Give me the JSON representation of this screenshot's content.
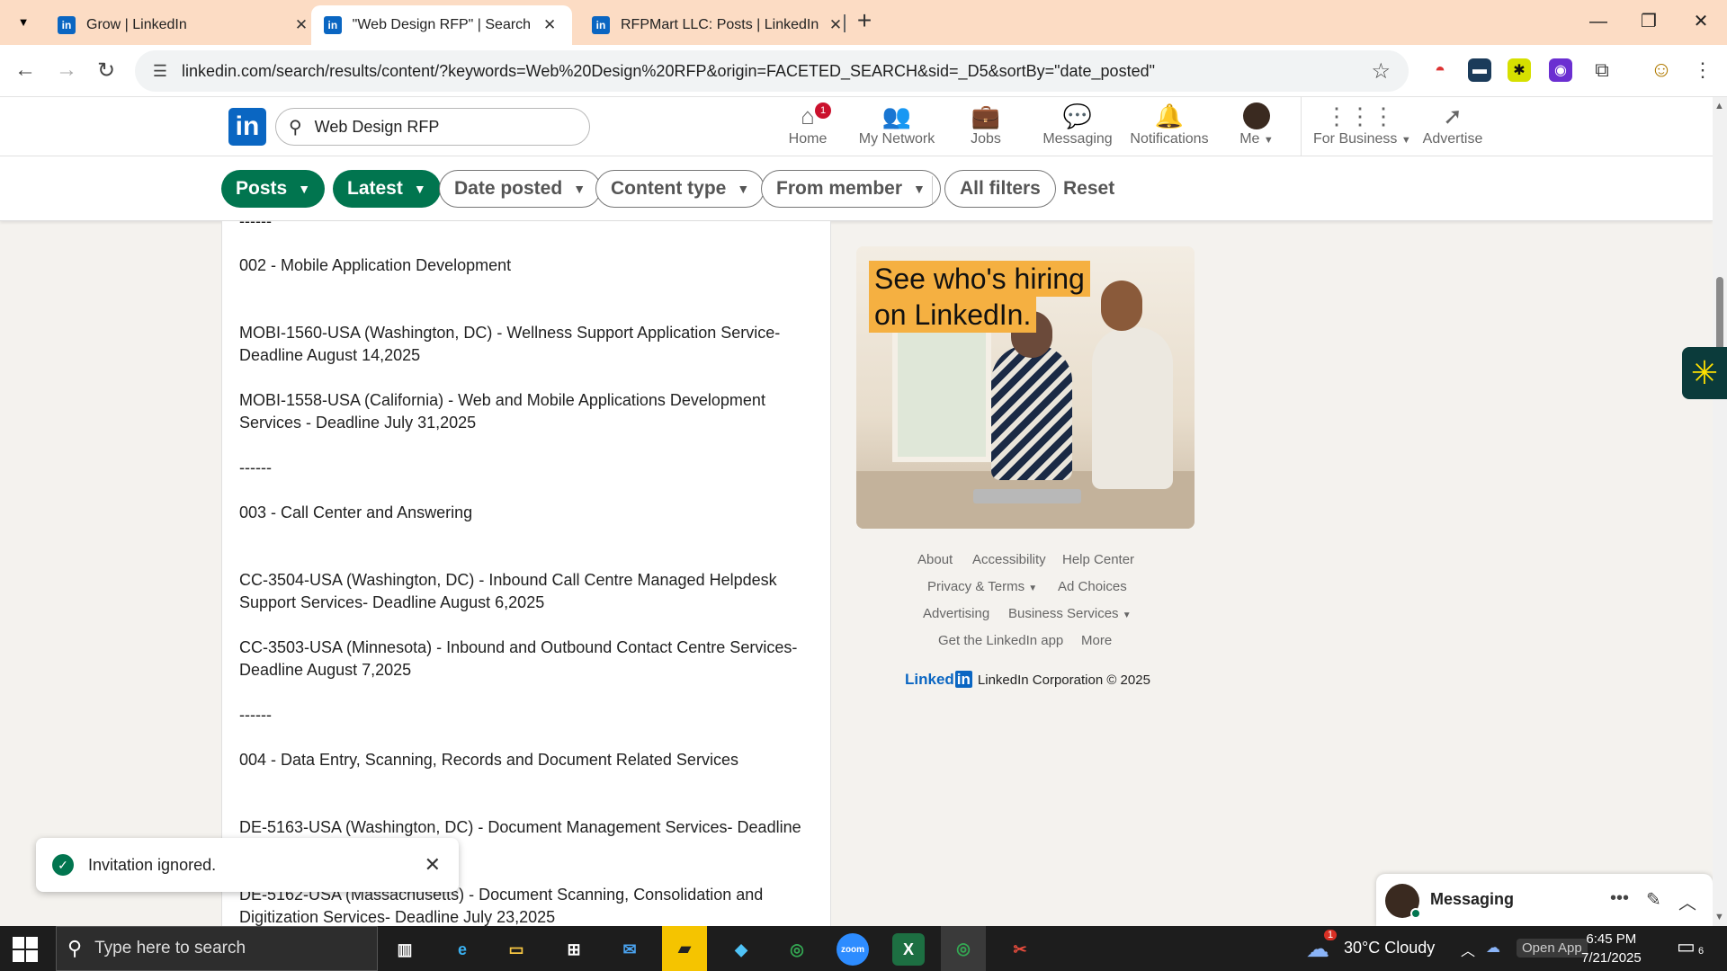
{
  "browser": {
    "tabs": [
      {
        "title": "Grow | LinkedIn",
        "active": false
      },
      {
        "title": "\"Web Design RFP\" | Search | LinkedIn",
        "active": true
      },
      {
        "title": "RFPMart LLC: Posts | LinkedIn",
        "active": false
      }
    ],
    "url": "linkedin.com/search/results/content/?keywords=Web%20Design%20RFP&origin=FACETED_SEARCH&sid=_D5&sortBy=\"date_posted\"",
    "tab_close_glyph": "✕",
    "new_tab_glyph": "+"
  },
  "linkedin": {
    "logo_text": "in",
    "search_value": "Web Design RFP",
    "nav": [
      {
        "label": "Home",
        "icon": "home-icon",
        "badge": "1"
      },
      {
        "label": "My Network",
        "icon": "network-icon"
      },
      {
        "label": "Jobs",
        "icon": "briefcase-icon"
      },
      {
        "label": "Messaging",
        "icon": "chat-icon"
      },
      {
        "label": "Notifications",
        "icon": "bell-icon"
      },
      {
        "label": "Me",
        "icon": "avatar"
      },
      {
        "label": "For Business",
        "icon": "grid-icon"
      },
      {
        "label": "Advertise",
        "icon": "compass-icon"
      }
    ],
    "filters": {
      "posts": "Posts",
      "latest": "Latest",
      "date_posted": "Date posted",
      "content_type": "Content type",
      "from_member": "From member",
      "all_filters": "All filters",
      "reset": "Reset"
    }
  },
  "post": {
    "lines": [
      "------",
      "002 - Mobile Application Development",
      "MOBI-1560-USA (Washington, DC) - Wellness Support Application Service- Deadline August 14,2025",
      "MOBI-1558-USA (California) - Web and Mobile Applications Development Services - Deadline July 31,2025",
      "------",
      "003 - Call Center and Answering",
      "CC-3504-USA (Washington, DC) - Inbound Call Centre Managed Helpdesk Support Services- Deadline August 6,2025",
      "CC-3503-USA (Minnesota) - Inbound and Outbound Contact Centre Services- Deadline August 7,2025",
      "------",
      "004 - Data Entry, Scanning, Records and Document Related Services",
      "DE-5163-USA (Washington, DC) - Document Management Services- Deadline July",
      "DE-5162-USA (Massachusetts) - Document Scanning, Consolidation and Digitization Services- Deadline July 23,2025"
    ]
  },
  "ad": {
    "line1": "See who's hiring",
    "line2": "on LinkedIn."
  },
  "footer": {
    "links": [
      "About",
      "Accessibility",
      "Help Center",
      "Privacy & Terms",
      "Ad Choices",
      "Advertising",
      "Business Services",
      "Get the LinkedIn app",
      "More"
    ],
    "wordmark": "Linked",
    "wordmark_in": "in",
    "copyright": "LinkedIn Corporation © 2025"
  },
  "toast": {
    "message": "Invitation ignored."
  },
  "messaging": {
    "title": "Messaging"
  },
  "taskbar": {
    "search_placeholder": "Type here to search",
    "weather": "30°C  Cloudy",
    "weather_badge": "1",
    "open_app": "Open App",
    "time": "6:45 PM",
    "date": "7/21/2025",
    "notification_count": "6"
  },
  "colors": {
    "linkedin_blue": "#0a66c2",
    "filter_green": "#01754f",
    "tab_strip": "#fcdcc4",
    "badge_red": "#cb112d"
  }
}
